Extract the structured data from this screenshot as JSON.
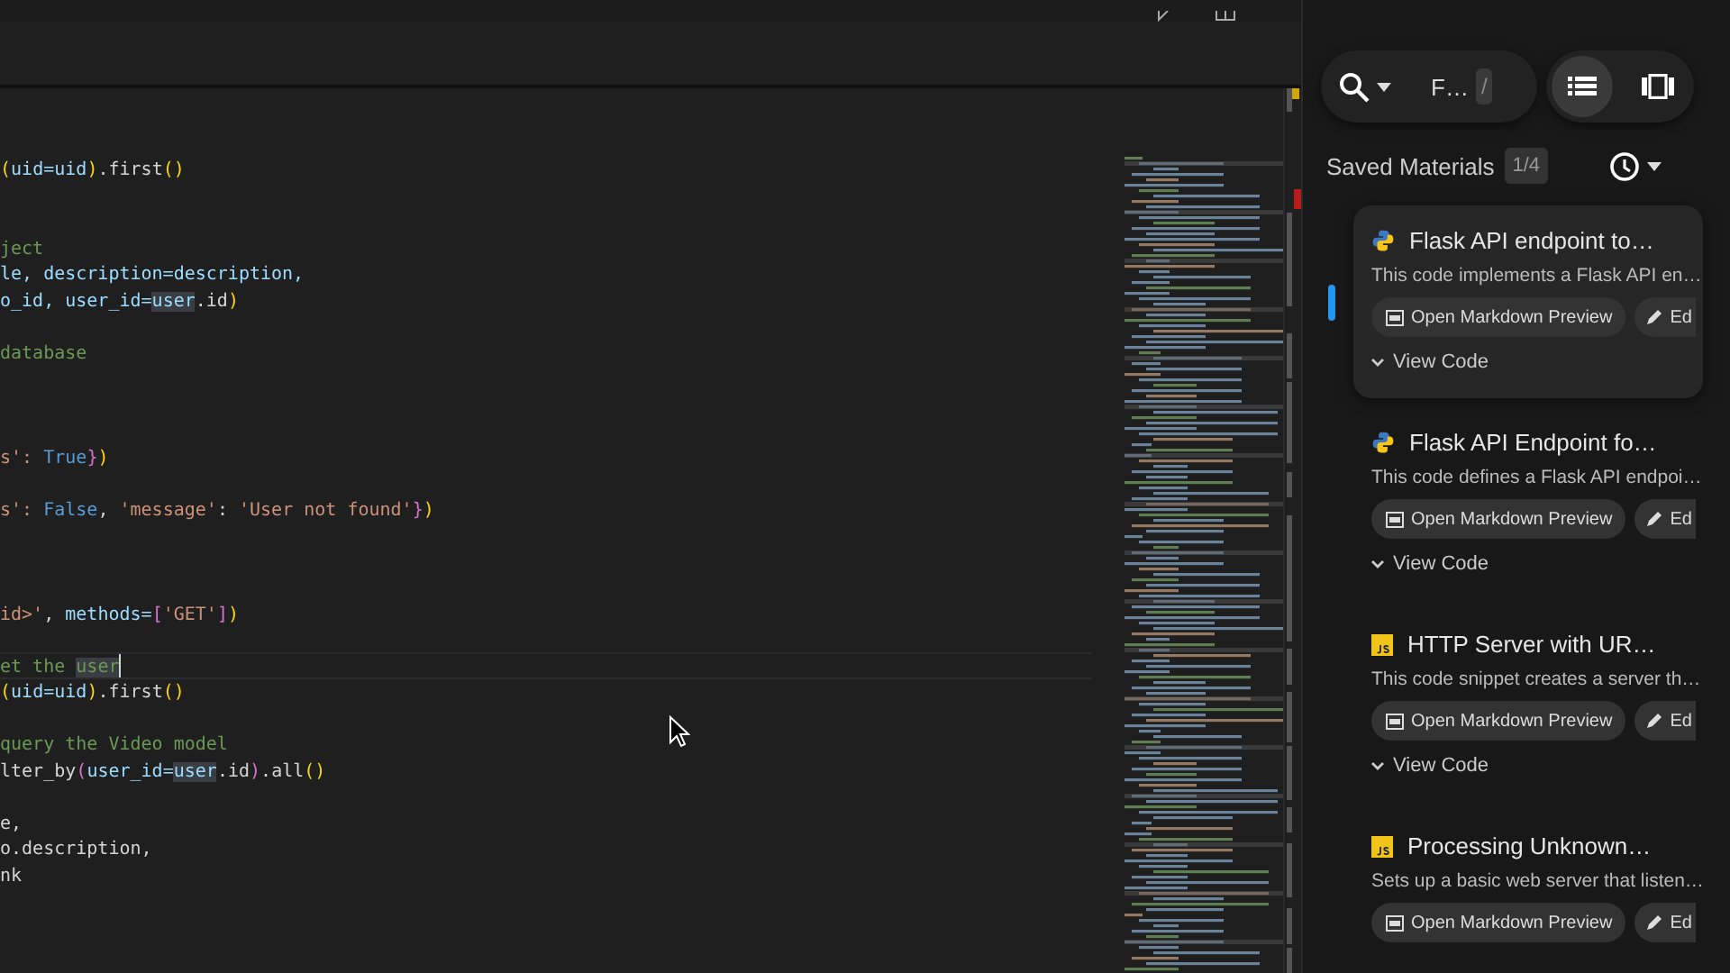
{
  "editor": {
    "lines": [
      {
        "kind": "code",
        "current": false,
        "segments": [
          {
            "text": "(",
            "kind": "paren"
          },
          {
            "text": "uid=uid",
            "kind": "var"
          },
          {
            "text": ")",
            "kind": "paren"
          },
          {
            "text": ".first",
            "kind": "plain"
          },
          {
            "text": "()",
            "kind": "paren"
          }
        ]
      },
      {
        "kind": "blank"
      },
      {
        "kind": "blank"
      },
      {
        "kind": "code",
        "current": false,
        "segments": [
          {
            "text": "ject",
            "kind": "comment"
          }
        ]
      },
      {
        "kind": "code",
        "current": false,
        "segments": [
          {
            "text": "le, description=description,",
            "kind": "var"
          }
        ]
      },
      {
        "kind": "code",
        "current": false,
        "segments": [
          {
            "text": "o_id, user_id=",
            "kind": "var"
          },
          {
            "text": "user",
            "kind": "var",
            "highlight": true
          },
          {
            "text": ".id",
            "kind": "plain"
          },
          {
            "text": ")",
            "kind": "paren"
          }
        ]
      },
      {
        "kind": "blank"
      },
      {
        "kind": "code",
        "current": false,
        "segments": [
          {
            "text": "database",
            "kind": "comment"
          }
        ]
      },
      {
        "kind": "blank"
      },
      {
        "kind": "blank"
      },
      {
        "kind": "blank"
      },
      {
        "kind": "code",
        "current": false,
        "segments": [
          {
            "text": "s': ",
            "kind": "string"
          },
          {
            "text": "True",
            "kind": "constant"
          },
          {
            "text": "}",
            "kind": "bracket"
          },
          {
            "text": ")",
            "kind": "paren"
          }
        ]
      },
      {
        "kind": "blank"
      },
      {
        "kind": "code",
        "current": false,
        "segments": [
          {
            "text": "s': ",
            "kind": "string"
          },
          {
            "text": "False",
            "kind": "constant"
          },
          {
            "text": ", ",
            "kind": "plain"
          },
          {
            "text": "'message'",
            "kind": "string"
          },
          {
            "text": ": ",
            "kind": "plain"
          },
          {
            "text": "'User not found'",
            "kind": "string"
          },
          {
            "text": "}",
            "kind": "bracket"
          },
          {
            "text": ")",
            "kind": "paren"
          }
        ]
      },
      {
        "kind": "blank"
      },
      {
        "kind": "blank"
      },
      {
        "kind": "blank"
      },
      {
        "kind": "code",
        "current": false,
        "segments": [
          {
            "text": "id>'",
            "kind": "string"
          },
          {
            "text": ", ",
            "kind": "plain"
          },
          {
            "text": "methods=",
            "kind": "var"
          },
          {
            "text": "[",
            "kind": "bracket"
          },
          {
            "text": "'GET'",
            "kind": "string"
          },
          {
            "text": "]",
            "kind": "bracket"
          },
          {
            "text": ")",
            "kind": "paren"
          }
        ]
      },
      {
        "kind": "blank"
      },
      {
        "kind": "code",
        "current": true,
        "segments": [
          {
            "text": "et the ",
            "kind": "comment"
          },
          {
            "text": "user",
            "kind": "comment",
            "highlight": true
          }
        ]
      },
      {
        "kind": "code",
        "current": false,
        "segments": [
          {
            "text": "(",
            "kind": "paren"
          },
          {
            "text": "uid=uid",
            "kind": "var"
          },
          {
            "text": ")",
            "kind": "paren"
          },
          {
            "text": ".first",
            "kind": "plain"
          },
          {
            "text": "()",
            "kind": "paren"
          }
        ]
      },
      {
        "kind": "blank"
      },
      {
        "kind": "code",
        "current": false,
        "segments": [
          {
            "text": "query the Video model",
            "kind": "comment"
          }
        ]
      },
      {
        "kind": "code",
        "current": false,
        "segments": [
          {
            "text": "lter_by",
            "kind": "plain"
          },
          {
            "text": "(",
            "kind": "bracket"
          },
          {
            "text": "user_id=",
            "kind": "var"
          },
          {
            "text": "user",
            "kind": "var",
            "highlight": true
          },
          {
            "text": ".id",
            "kind": "plain"
          },
          {
            "text": ")",
            "kind": "bracket"
          },
          {
            "text": ".all",
            "kind": "plain"
          },
          {
            "text": "()",
            "kind": "paren"
          }
        ]
      },
      {
        "kind": "blank"
      },
      {
        "kind": "code",
        "current": false,
        "segments": [
          {
            "text": "e,",
            "kind": "plain"
          }
        ]
      },
      {
        "kind": "code",
        "current": false,
        "segments": [
          {
            "text": "o.description,",
            "kind": "plain"
          }
        ]
      },
      {
        "kind": "code",
        "current": false,
        "segments": [
          {
            "text": "nk",
            "kind": "plain"
          }
        ]
      }
    ]
  },
  "panel": {
    "search": {
      "value": "F…",
      "shortcut": "/"
    },
    "view_modes": [
      {
        "kind": "list",
        "selected": true
      },
      {
        "kind": "carousel",
        "selected": false
      }
    ],
    "section_title": "Saved Materials",
    "count": "1/4",
    "materials": [
      {
        "kind": "python",
        "title": "Flask API endpoint to…",
        "description": "This code implements a Flask API en…",
        "preview_button": "Open Markdown Preview",
        "edit_button": "Ed",
        "view_code": "View Code",
        "selected": true
      },
      {
        "kind": "python",
        "title": "Flask API Endpoint fo…",
        "description": "This code defines a Flask API endpoi…",
        "preview_button": "Open Markdown Preview",
        "edit_button": "Ed",
        "view_code": "View Code",
        "selected": false
      },
      {
        "kind": "javascript",
        "title": "HTTP Server with UR…",
        "description": "This code snippet creates a server th…",
        "preview_button": "Open Markdown Preview",
        "edit_button": "Ed",
        "view_code": "View Code",
        "selected": false
      },
      {
        "kind": "javascript",
        "title": "Processing Unknown…",
        "description": "Sets up a basic web server that listen…",
        "preview_button": "Open Markdown Preview",
        "edit_button": "Ed",
        "selected": false
      }
    ]
  }
}
